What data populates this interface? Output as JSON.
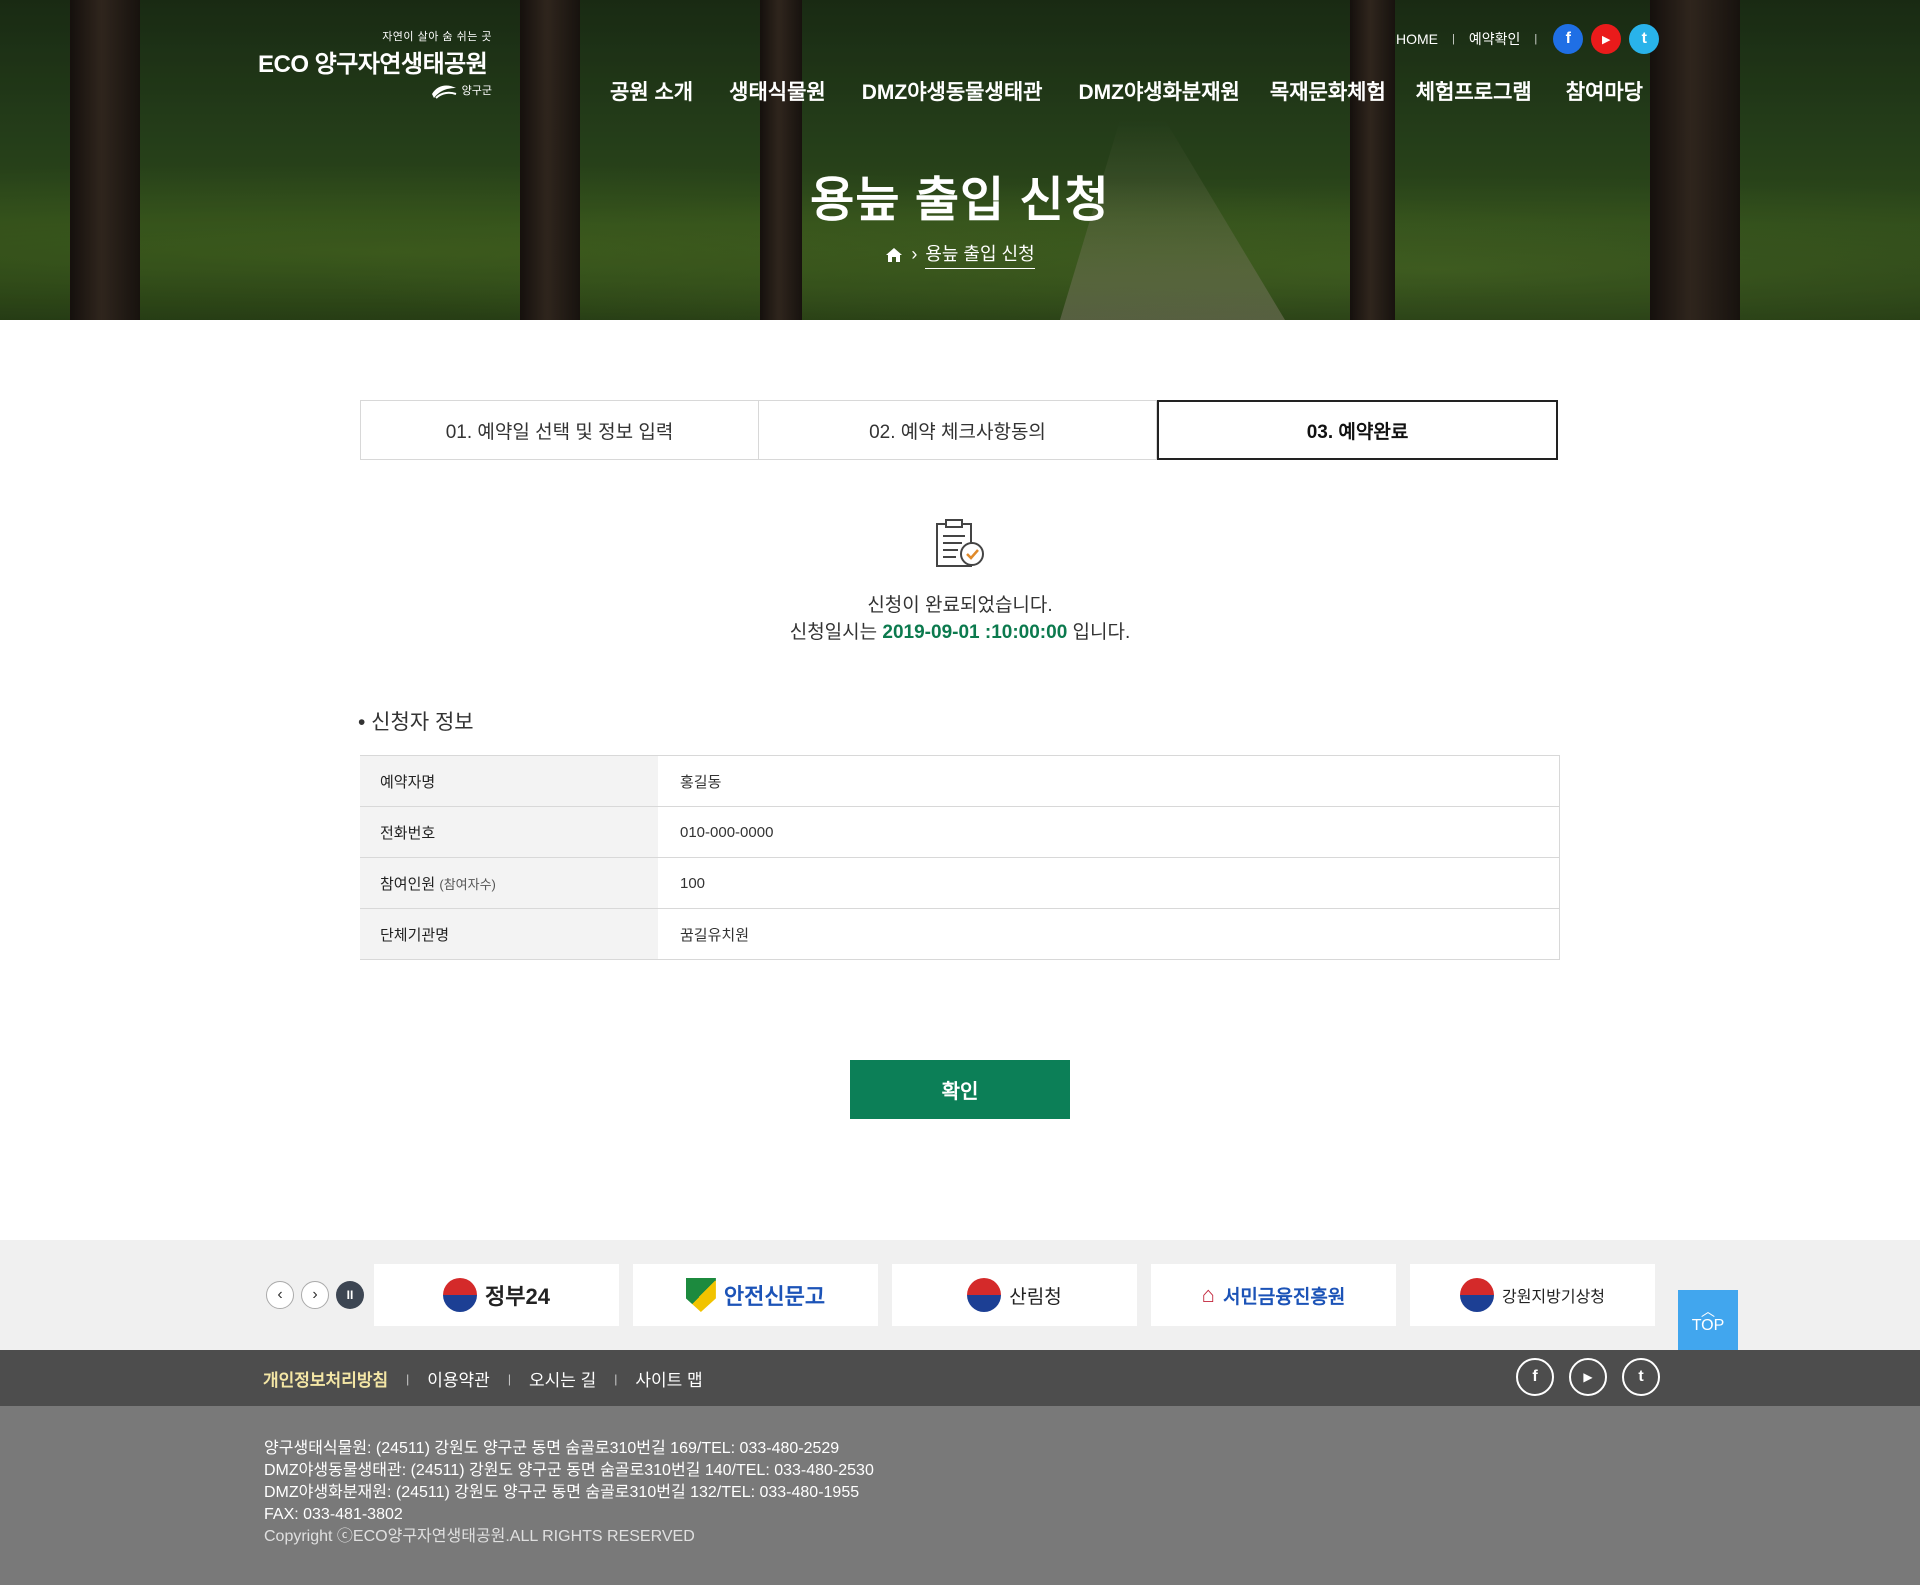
{
  "header": {
    "logo": {
      "tagline": "자연이 살아 숨 쉬는 곳",
      "name": "ECO 양구자연생태공원",
      "county": "양구군"
    },
    "util_links": [
      "HOME",
      "예약확인"
    ],
    "social": {
      "facebook": "f",
      "youtube": "▶",
      "twitter": "t"
    },
    "nav": [
      "공원 소개",
      "생태식물원",
      "DMZ야생동물생태관",
      "DMZ야생화분재원",
      "목재문화체험",
      "체험프로그램",
      "참여마당"
    ],
    "page_title": "용늪 출입 신청",
    "breadcrumb": "용늪 출입 신청"
  },
  "steps": [
    {
      "label": "01. 예약일 선택 및 정보 입력",
      "active": false
    },
    {
      "label": "02. 예약 체크사항동의",
      "active": false
    },
    {
      "label": "03. 예약완료",
      "active": true
    }
  ],
  "result": {
    "line1": "신청이 완료되었습니다.",
    "line2_prefix": "신청일시는 ",
    "datetime": "2019-09-01 :10:00:00",
    "line2_suffix": " 입니다."
  },
  "applicant": {
    "title": "• 신청자 정보",
    "rows": [
      {
        "label": "예약자명",
        "sub": "",
        "value": "홍길동"
      },
      {
        "label": "전화번호",
        "sub": "",
        "value": "010-000-0000"
      },
      {
        "label": "참여인원 ",
        "sub": "(참여자수)",
        "value": "100"
      },
      {
        "label": "단체기관명",
        "sub": "",
        "value": "꿈길유치원"
      }
    ]
  },
  "confirm_label": "확인",
  "banner": {
    "controls": {
      "prev": "‹",
      "next": "›",
      "pause": "II"
    },
    "logos": [
      "정부24",
      "안전신문고",
      "산림청",
      "서민금융진흥원",
      "강원지방기상청"
    ],
    "top_label": "TOP"
  },
  "footer": {
    "links": [
      "개인정보처리방침",
      "이용약관",
      "오시는 길",
      "사이트 맵"
    ],
    "info": [
      "양구생태식물원: (24511) 강원도 양구군 동면 숨골로310번길 169/TEL: 033-480-2529",
      "DMZ야생동물생태관: (24511) 강원도 양구군 동면 숨골로310번길 140/TEL: 033-480-2530",
      "DMZ야생화분재원: (24511) 강원도 양구군 동면 숨골로310번길 132/TEL: 033-480-1955",
      "FAX: 033-481-3802"
    ],
    "copyright": "Copyright ⓒECO양구자연생태공원.ALL RIGHTS RESERVED"
  },
  "colors": {
    "accent_green": "#0c7f57",
    "datetime_green": "#0c7a4e",
    "top_button": "#41a6ee",
    "footer_dark": "#4d4d4d",
    "footer_info": "#797979"
  }
}
